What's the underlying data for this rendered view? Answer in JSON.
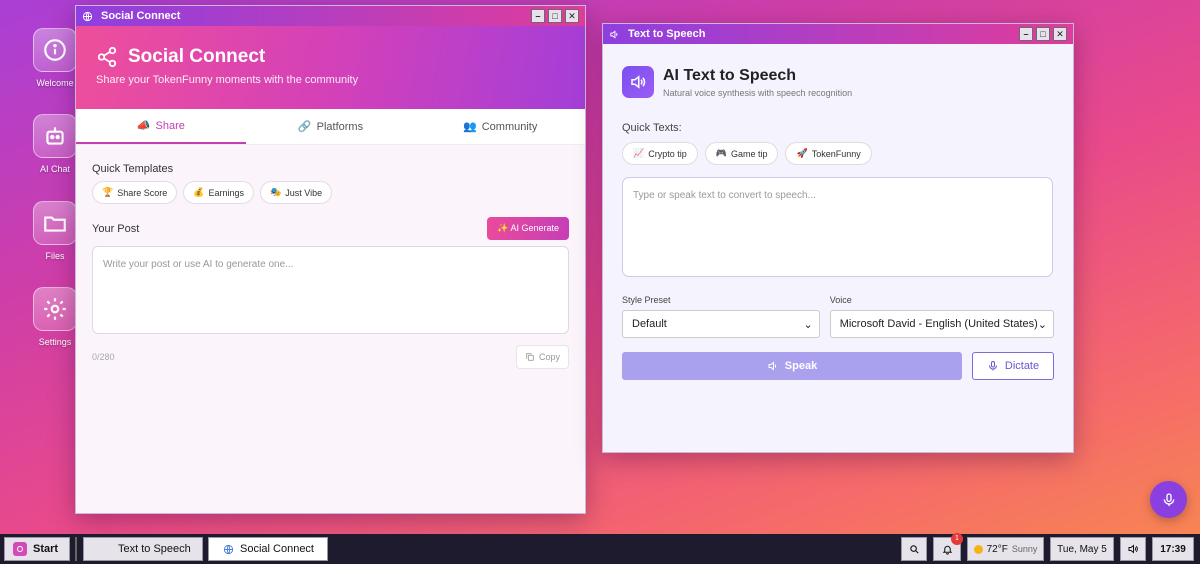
{
  "desktop": {
    "icons": [
      {
        "label": "Welcome",
        "icon": "info-icon"
      },
      {
        "label": "AI Chat",
        "icon": "robot-icon"
      },
      {
        "label": "Files",
        "icon": "folder-icon"
      },
      {
        "label": "Settings",
        "icon": "gear-icon"
      }
    ]
  },
  "social": {
    "window_title": "Social Connect",
    "header_title": "Social Connect",
    "header_subtitle": "Share your TokenFunny moments with the community",
    "tabs": [
      {
        "label": "Share",
        "icon": "megaphone-icon",
        "active": true
      },
      {
        "label": "Platforms",
        "icon": "link-icon",
        "active": false
      },
      {
        "label": "Community",
        "icon": "users-icon",
        "active": false
      }
    ],
    "quick_templates_label": "Quick Templates",
    "templates": [
      {
        "emoji": "🏆",
        "label": "Share Score"
      },
      {
        "emoji": "💰",
        "label": "Earnings"
      },
      {
        "emoji": "🎭",
        "label": "Just Vibe"
      }
    ],
    "post_label": "Your Post",
    "ai_generate_label": "✨ AI Generate",
    "post_placeholder": "Write your post or use AI to generate one...",
    "counter": "0/280",
    "copy_label": "Copy"
  },
  "tts": {
    "window_title": "Text to Speech",
    "title": "AI Text to Speech",
    "subtitle": "Natural voice synthesis with speech recognition",
    "quick_texts_label": "Quick Texts:",
    "quick_texts": [
      {
        "emoji": "📈",
        "label": "Crypto tip"
      },
      {
        "emoji": "🎮",
        "label": "Game tip"
      },
      {
        "emoji": "🚀",
        "label": "TokenFunny"
      }
    ],
    "textarea_placeholder": "Type or speak text to convert to speech...",
    "style_label": "Style Preset",
    "style_value": "Default",
    "voice_label": "Voice",
    "voice_value": "Microsoft David - English (United States)",
    "speak_label": "Speak",
    "dictate_label": "Dictate"
  },
  "taskbar": {
    "start_label": "Start",
    "windows": [
      {
        "label": "Text to Speech",
        "active": false
      },
      {
        "label": "Social Connect",
        "active": true
      }
    ],
    "notification_count": "1",
    "weather": "72°F",
    "weather_desc": "Sunny",
    "date": "Tue, May 5",
    "time": "17:39"
  },
  "colors": {
    "accent_pink": "#e03c9b",
    "accent_purple": "#8e3fe0",
    "tts_accent": "#7b4ff0"
  }
}
